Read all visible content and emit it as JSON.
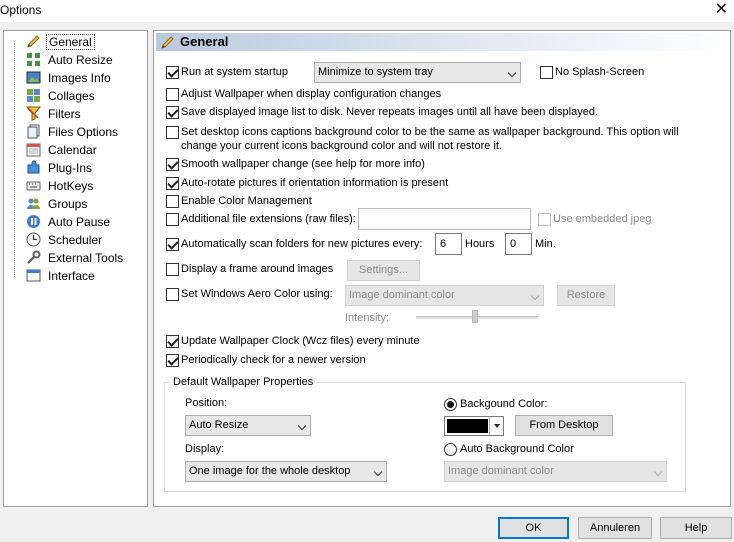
{
  "window": {
    "title": "Options",
    "close_glyph": "✕"
  },
  "sidebar": {
    "items": [
      {
        "label": "General",
        "icon": "pencil-icon"
      },
      {
        "label": "Auto Resize",
        "icon": "resize-icon"
      },
      {
        "label": "Images Info",
        "icon": "image-icon"
      },
      {
        "label": "Collages",
        "icon": "collage-icon"
      },
      {
        "label": "Filters",
        "icon": "filter-icon"
      },
      {
        "label": "Files Options",
        "icon": "files-icon"
      },
      {
        "label": "Calendar",
        "icon": "calendar-icon"
      },
      {
        "label": "Plug-Ins",
        "icon": "plugin-icon"
      },
      {
        "label": "HotKeys",
        "icon": "keyboard-icon"
      },
      {
        "label": "Groups",
        "icon": "groups-icon"
      },
      {
        "label": "Auto Pause",
        "icon": "pause-icon"
      },
      {
        "label": "Scheduler",
        "icon": "clock-icon"
      },
      {
        "label": "External Tools",
        "icon": "tools-icon"
      },
      {
        "label": "Interface",
        "icon": "window-icon"
      }
    ]
  },
  "panel": {
    "title": "General",
    "run_startup": {
      "label": "Run at system startup",
      "checked": true
    },
    "startup_mode": {
      "value": "Minimize to system tray"
    },
    "no_splash": {
      "label": "No Splash-Screen",
      "checked": false
    },
    "adjust_wallpaper": {
      "label": "Adjust Wallpaper when display configuration changes",
      "checked": false
    },
    "save_list": {
      "label": "Save displayed image list to disk. Never repeats images until all have been displayed.",
      "checked": true
    },
    "desktop_icons": {
      "label_line1": "Set desktop icons captions background color to be the same as wallpaper background. This option will",
      "label_line2": "change your current icons background color and will not restore it.",
      "checked": false
    },
    "smooth_change": {
      "label": "Smooth wallpaper change (see help for more info)",
      "checked": true
    },
    "auto_rotate": {
      "label": "Auto-rotate pictures if orientation information is present",
      "checked": true
    },
    "color_mgmt": {
      "label": "Enable Color Management",
      "checked": false
    },
    "extra_ext": {
      "label": "Additional file extensions (raw files):",
      "checked": false,
      "value": ""
    },
    "embedded_jpeg": {
      "label": "Use embedded jpeg",
      "checked": false
    },
    "auto_scan": {
      "label": "Automatically scan folders for new pictures every:",
      "checked": true,
      "hours": "6",
      "hours_label": "Hours",
      "minutes": "0",
      "minutes_label": "Min."
    },
    "frame": {
      "label": "Display a frame around images",
      "checked": false,
      "button": "Settings..."
    },
    "aero": {
      "label": "Set Windows Aero Color using:",
      "checked": false,
      "value": "Image dominant color",
      "button": "Restore",
      "intensity_label": "Intensity:"
    },
    "update_clock": {
      "label": "Update Wallpaper Clock (Wcz files) every minute",
      "checked": true
    },
    "check_newer": {
      "label": "Periodically check for a newer version",
      "checked": true
    },
    "defaults": {
      "title": "Default Wallpaper Properties",
      "position_label": "Position:",
      "position_value": "Auto Resize",
      "display_label": "Display:",
      "display_value": "One image for the whole desktop",
      "bg_color_label": "Backgound Color:",
      "bg_color": "#000000",
      "from_desktop": "From Desktop",
      "auto_bg_label": "Auto Background Color",
      "auto_bg_value": "Image dominant color"
    }
  },
  "footer": {
    "ok": "OK",
    "cancel": "Annuleren",
    "help": "Help"
  }
}
